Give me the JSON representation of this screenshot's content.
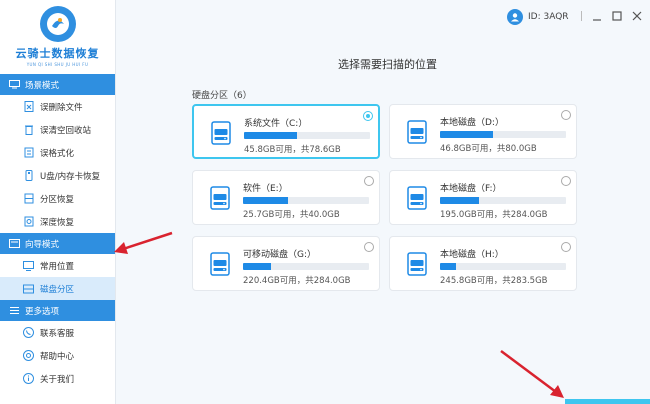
{
  "app": {
    "title": "云骑士数据恢复",
    "subtitle": "YUN QI SHI SHU JU HUI FU",
    "user_id": "ID: 3AQR"
  },
  "sidebar": {
    "sections": [
      {
        "header": "场景模式",
        "items": [
          "误删除文件",
          "误清空回收站",
          "误格式化",
          "U盘/内存卡恢复",
          "分区恢复",
          "深度恢复"
        ]
      },
      {
        "header": "向导模式",
        "items": [
          "常用位置",
          "磁盘分区"
        ]
      },
      {
        "header": "更多选项",
        "items": [
          "联系客服",
          "帮助中心",
          "关于我们"
        ]
      }
    ],
    "active_item": "磁盘分区"
  },
  "main": {
    "title": "选择需要扫描的位置",
    "partition_label": "硬盘分区（6）",
    "disks": [
      {
        "name": "系统文件（C:）",
        "info": "45.8GB可用，共78.6GB",
        "used_fraction": 0.42,
        "selected": true
      },
      {
        "name": "本地磁盘（D:）",
        "info": "46.8GB可用，共80.0GB",
        "used_fraction": 0.42,
        "selected": false
      },
      {
        "name": "软件（E:）",
        "info": "25.7GB可用，共40.0GB",
        "used_fraction": 0.36,
        "selected": false
      },
      {
        "name": "本地磁盘（F:）",
        "info": "195.0GB可用，共284.0GB",
        "used_fraction": 0.31,
        "selected": false
      },
      {
        "name": "可移动磁盘（G:）",
        "info": "220.4GB可用，共284.0GB",
        "used_fraction": 0.22,
        "selected": false
      },
      {
        "name": "本地磁盘（H:）",
        "info": "245.8GB可用，共283.5GB",
        "used_fraction": 0.13,
        "selected": false
      }
    ]
  },
  "colors": {
    "accent": "#2f8fe0",
    "selected_border": "#3ec6ef",
    "bar_fill": "#1e8ae6",
    "arrow": "#d9232f"
  },
  "icons": {
    "logo": "logo-icon",
    "user": "user-icon",
    "disk": "hard-disk-icon",
    "minimize": "minimize-icon",
    "maximize": "maximize-icon",
    "close": "close-icon"
  }
}
